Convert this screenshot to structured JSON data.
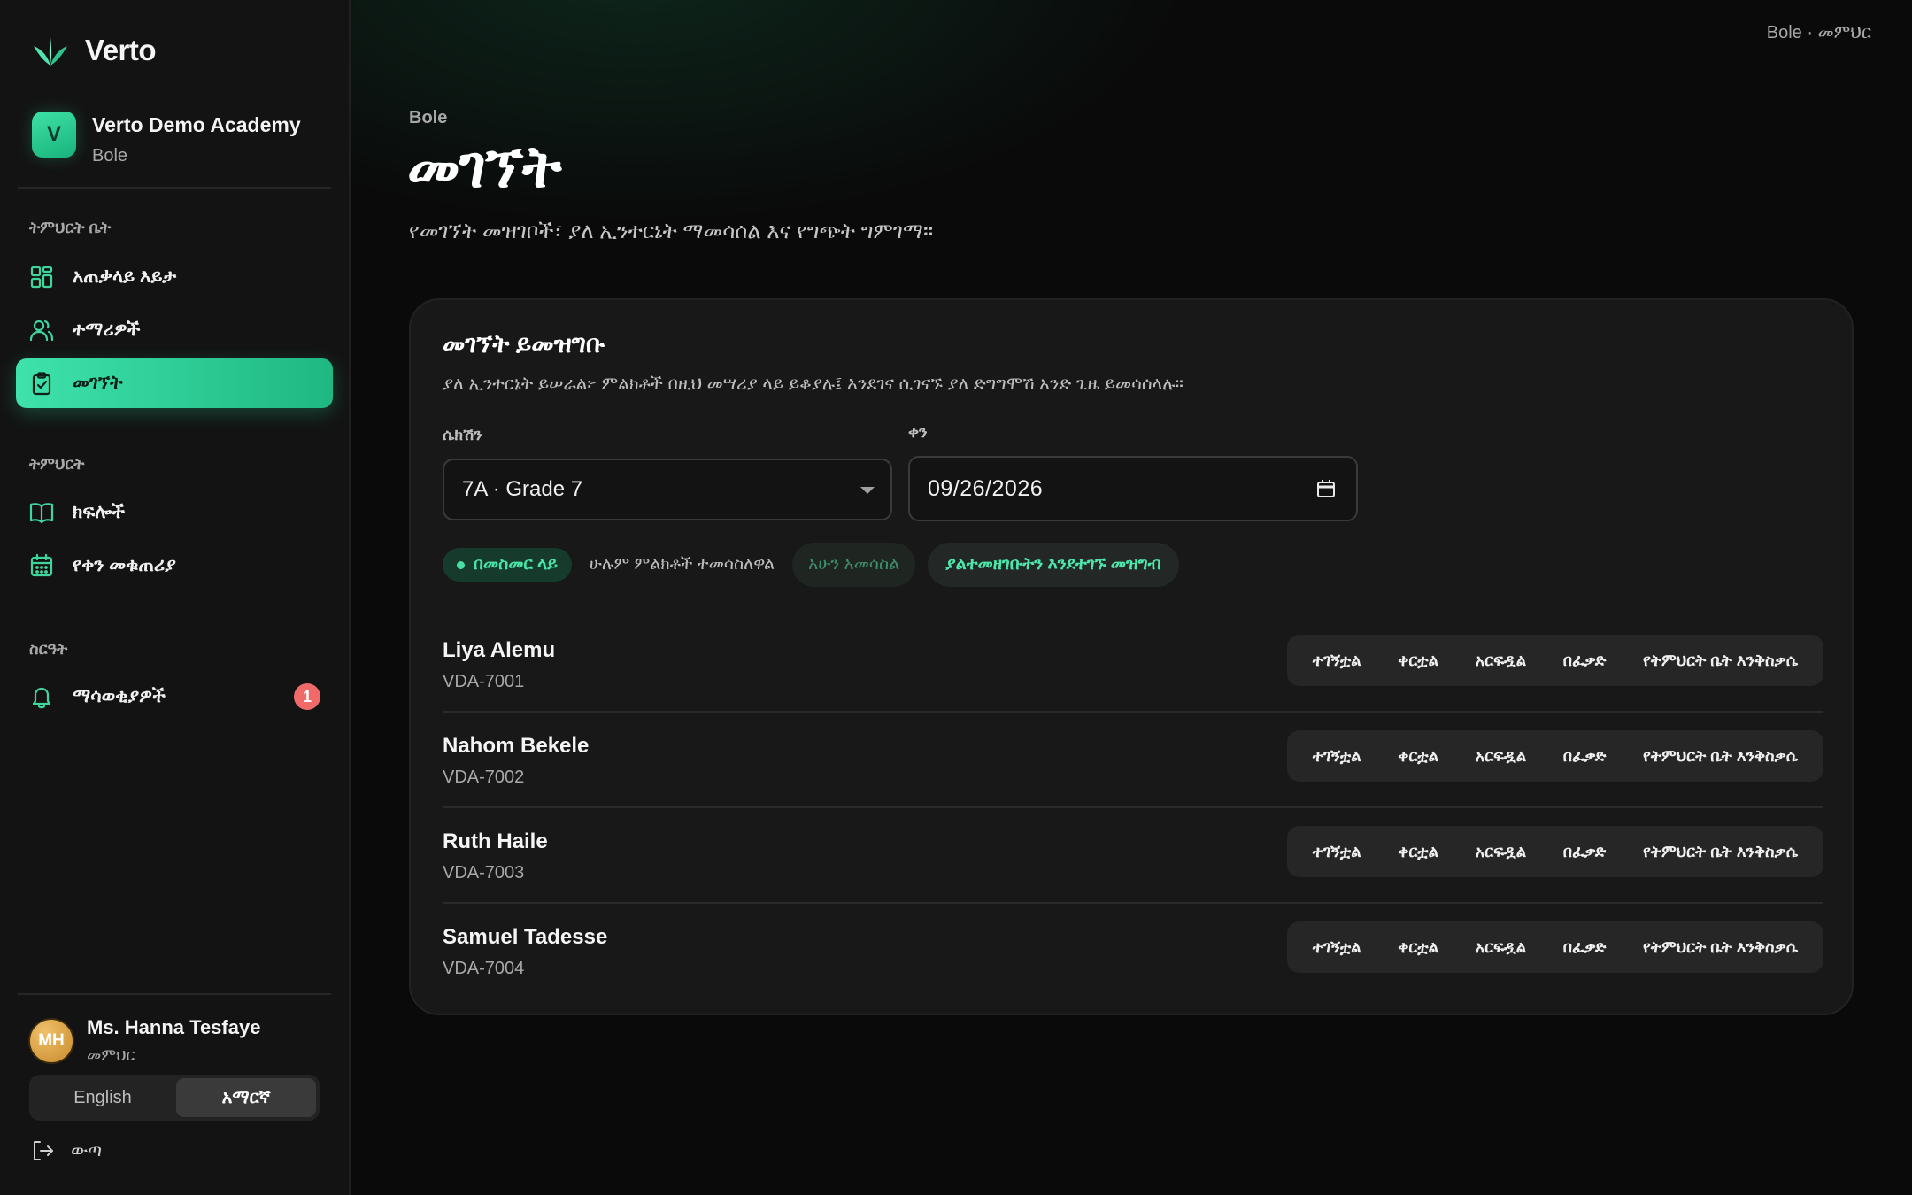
{
  "brand": {
    "name": "Verto"
  },
  "school": {
    "initial": "V",
    "name": "Verto Demo Academy",
    "branch": "Bole"
  },
  "sidebar": {
    "sections": [
      {
        "label": "ትምህርት ቤት"
      },
      {
        "label": "ትምህርት"
      },
      {
        "label": "ስርዓት"
      }
    ],
    "items": [
      {
        "label": "አጠቃላይ እይታ",
        "icon": "dashboard-icon"
      },
      {
        "label": "ተማሪዎች",
        "icon": "users-icon"
      },
      {
        "label": "መገኘት",
        "icon": "clipboard-check-icon",
        "active": true
      },
      {
        "label": "ክፍሎች",
        "icon": "book-icon"
      },
      {
        "label": "የቀን መቁጠሪያ",
        "icon": "calendar-icon"
      },
      {
        "label": "ማሳወቂያዎች",
        "icon": "bell-icon",
        "badge": "1"
      }
    ]
  },
  "user": {
    "initials": "MH",
    "name": "Ms. Hanna Tesfaye",
    "role": "መምህር"
  },
  "language": {
    "options": [
      "English",
      "አማርኛ"
    ],
    "selected": "አማርኛ"
  },
  "logout": {
    "label": "ውጣ"
  },
  "header": {
    "context": "Bole · መምህር",
    "breadcrumb": "Bole",
    "title": "መገኘት",
    "subtitle": "የመገኘት መዝገቦች፣ ያለ ኢንተርኔት ማመሳሰል እና የግጭት ግምገማ።"
  },
  "card": {
    "title": "መገኘት ይመዝግቡ",
    "description": "ያለ ኢንተርኔት ይሠራል፦ ምልክቶች በዚህ መሣሪያ ላይ ይቆያሉ፤ እንደገና ሲገናኙ ያለ ድግግሞሽ አንድ ጊዜ ይመሳሰላሉ።",
    "section_label": "ሴክሽን",
    "section_value": "7A · Grade 7",
    "date_label": "ቀን",
    "date_value": "09/26/2026",
    "online_label": "በመስመር ላይ",
    "sync_status": "ሁሉም ምልክቶች ተመሳስለዋል",
    "sync_button": "አሁን አመሳስል",
    "mark_button": "ያልተመዘገቡትን እንደተገኙ መዝግብ",
    "status_options": [
      "ተገኝቷል",
      "ቀርቷል",
      "አርፍዷል",
      "በፈቃድ",
      "የትምህርት ቤት እንቅስቃሴ"
    ]
  },
  "students": [
    {
      "name": "Liya Alemu",
      "id": "VDA-7001"
    },
    {
      "name": "Nahom Bekele",
      "id": "VDA-7002"
    },
    {
      "name": "Ruth Haile",
      "id": "VDA-7003"
    },
    {
      "name": "Samuel Tadesse",
      "id": "VDA-7004"
    }
  ],
  "colors": {
    "accent": "#3fe2ab",
    "background": "#0a0a0a",
    "sidebar": "#131313",
    "card": "#181818",
    "badge": "#f06a6a"
  }
}
